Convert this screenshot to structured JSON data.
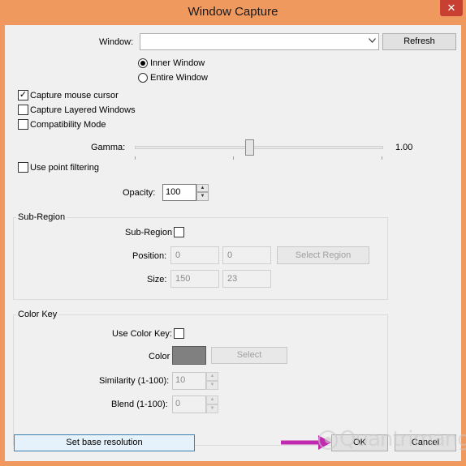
{
  "window": {
    "title": "Window Capture",
    "close_glyph": "✕"
  },
  "source": {
    "window_label": "Window:",
    "window_value": "",
    "refresh_label": "Refresh",
    "inner_window_label": "Inner Window",
    "entire_window_label": "Entire Window",
    "selected_mode": "Inner Window"
  },
  "options": {
    "capture_mouse_cursor": {
      "label": "Capture mouse cursor",
      "checked": true
    },
    "capture_layered_windows": {
      "label": "Capture Layered Windows",
      "checked": false
    },
    "compatibility_mode": {
      "label": "Compatibility Mode",
      "checked": false
    },
    "use_point_filtering": {
      "label": "Use point filtering",
      "checked": false
    }
  },
  "gamma": {
    "label": "Gamma:",
    "value_text": "1.00",
    "level": 0.5
  },
  "opacity": {
    "label": "Opacity:",
    "value": "100"
  },
  "sub_region": {
    "group_title": "Sub-Region",
    "toggle_label": "Sub-Region",
    "checked": false,
    "position_label": "Position:",
    "position_x": "0",
    "position_y": "0",
    "select_region_label": "Select Region",
    "size_label": "Size:",
    "size_w": "150",
    "size_h": "23"
  },
  "color_key": {
    "group_title": "Color Key",
    "use_label": "Use Color Key:",
    "checked": false,
    "color_label": "Color",
    "color_hex": "#808080",
    "select_label": "Select",
    "similarity_label": "Similarity (1-100):",
    "similarity_value": "10",
    "blend_label": "Blend (1-100):",
    "blend_value": "0"
  },
  "footer": {
    "base_resolution_label": "Set base resolution",
    "ok_label": "OK",
    "cancel_label": "Cancel"
  },
  "watermark": {
    "text": "Quantrimang"
  },
  "colors": {
    "title_bar": "#f0995f",
    "close_button": "#c84032",
    "client_bg": "#f0f0f0",
    "focus_border": "#3c7fb1",
    "arrow_magenta": "#c02ab0"
  }
}
